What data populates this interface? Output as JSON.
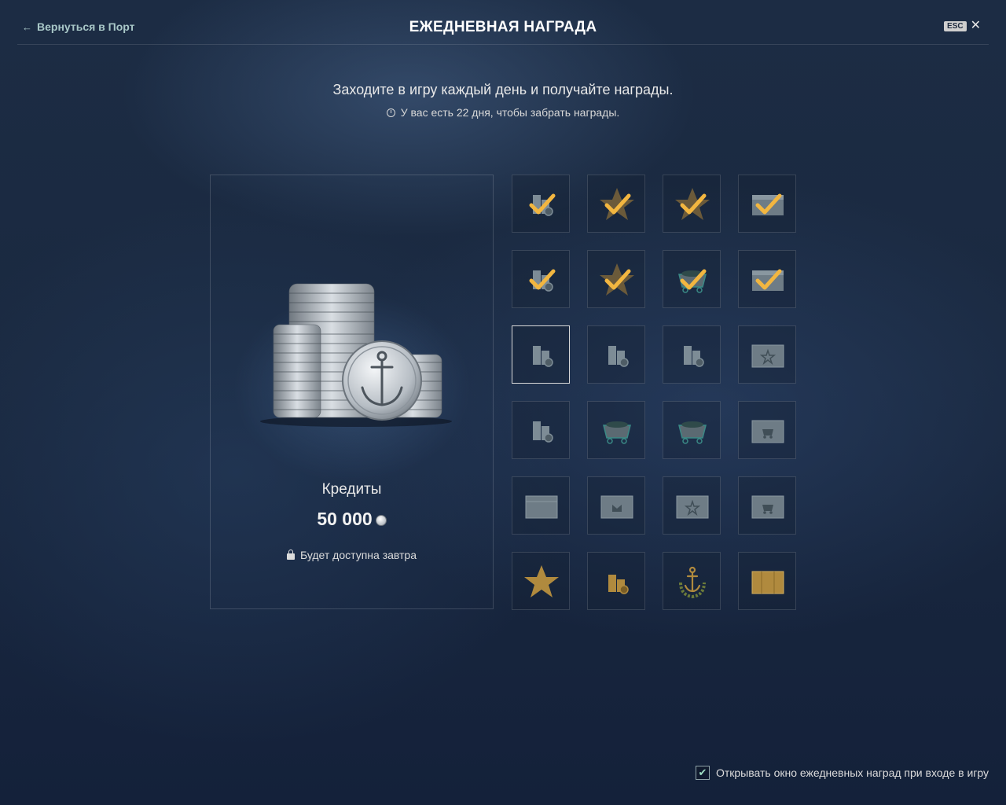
{
  "header": {
    "back_label": "Вернуться в Порт",
    "title": "ЕЖЕДНЕВНАЯ НАГРАДА",
    "esc_key": "ESC",
    "close_glyph": "✕"
  },
  "intro": {
    "text": "Заходите в игру каждый день и получайте награды.",
    "timer_text": "У вас есть 22 дня, чтобы забрать награды."
  },
  "selected_reward": {
    "name": "Кредиты",
    "amount": "50 000",
    "availability": "Будет доступна завтра",
    "icon": "credits-stack-anchor-coin"
  },
  "rewards": [
    {
      "icon": "credits",
      "claimed": true
    },
    {
      "icon": "star",
      "claimed": true
    },
    {
      "icon": "star",
      "claimed": true
    },
    {
      "icon": "container",
      "claimed": true
    },
    {
      "icon": "credits",
      "claimed": true
    },
    {
      "icon": "star",
      "claimed": true
    },
    {
      "icon": "coal-cart",
      "claimed": true
    },
    {
      "icon": "container",
      "claimed": true
    },
    {
      "icon": "credits",
      "claimed": false,
      "selected": true
    },
    {
      "icon": "credits",
      "claimed": false
    },
    {
      "icon": "credits",
      "claimed": false
    },
    {
      "icon": "container-star",
      "claimed": false
    },
    {
      "icon": "credits",
      "claimed": false
    },
    {
      "icon": "coal-cart",
      "claimed": false
    },
    {
      "icon": "coal-cart",
      "claimed": false
    },
    {
      "icon": "container-cart",
      "claimed": false
    },
    {
      "icon": "container-plain",
      "claimed": false
    },
    {
      "icon": "container-box",
      "claimed": false
    },
    {
      "icon": "container-star",
      "claimed": false
    },
    {
      "icon": "container-cart",
      "claimed": false
    },
    {
      "icon": "gold-star",
      "claimed": false
    },
    {
      "icon": "doubloons",
      "claimed": false
    },
    {
      "icon": "anchor-wreath",
      "claimed": false
    },
    {
      "icon": "gold-container",
      "claimed": false
    }
  ],
  "footer": {
    "checkbox_checked": true,
    "checkbox_label": "Открывать окно ежедневных наград при входе в игру"
  },
  "colors": {
    "check": "#f2b640",
    "item_gray": "#7d8c96",
    "gold": "#b08a3e",
    "teal": "#3a8a86"
  }
}
